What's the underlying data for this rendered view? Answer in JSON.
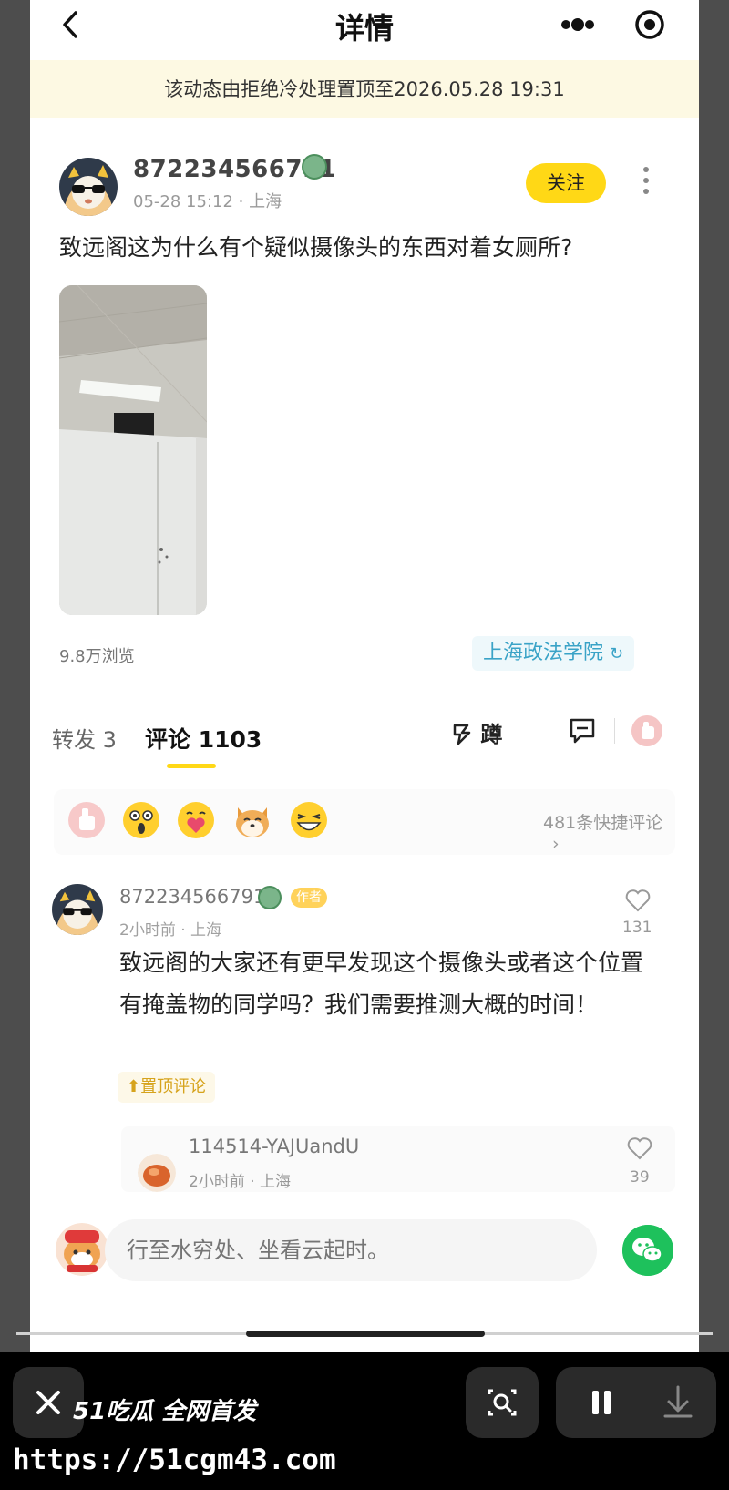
{
  "header": {
    "title": "详情"
  },
  "pin_banner": "该动态由拒绝冷处理置顶至2026.05.28 19:31",
  "post": {
    "author": "872234566791",
    "time": "05-28 15:12",
    "location": "上海",
    "follow_label": "关注",
    "text": "致远阁这为什么有个疑似摄像头的东西对着女厕所?",
    "views": "9.8万浏览",
    "school": "上海政法学院"
  },
  "tabs": {
    "forward_label": "转发",
    "forward_count": "3",
    "comment_label": "评论",
    "comment_count": "1103",
    "squat_label": "蹲"
  },
  "quick_comments": "481条快捷评论",
  "comment": {
    "author": "872234566791",
    "author_tag": "作者",
    "time": "2小时前",
    "location": "上海",
    "text": "致远阁的大家还有更早发现这个摄像头或者这个位置有掩盖物的同学吗？我们需要推测大概的时间！",
    "pin_label": "置顶评论",
    "likes": "131"
  },
  "reply": {
    "author": "114514-YAJUandU",
    "time": "2小时前",
    "location": "上海",
    "likes": "39"
  },
  "input": {
    "placeholder": "行至水穷处、坐看云起时。"
  },
  "watermark": {
    "brand": "51吃瓜 全网首发",
    "url": "https://51cgm43.com"
  },
  "colors": {
    "accent": "#ffd816",
    "school": "#3aa3c7",
    "wechat": "#1ec15c"
  }
}
